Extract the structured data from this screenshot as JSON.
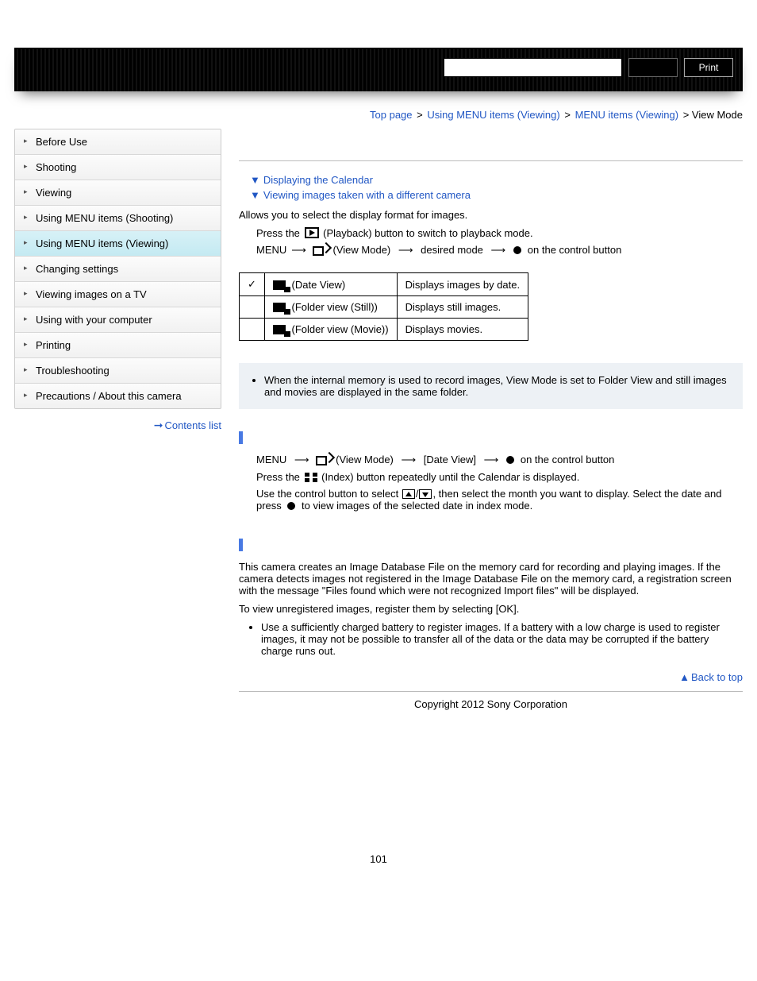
{
  "header": {
    "print_label": "Print"
  },
  "breadcrumbs": {
    "items": [
      "Top page",
      "Using MENU items (Viewing)",
      "MENU items (Viewing)"
    ],
    "current": "View Mode",
    "sep": ">"
  },
  "sidebar": {
    "items": [
      {
        "label": "Before Use"
      },
      {
        "label": "Shooting"
      },
      {
        "label": "Viewing"
      },
      {
        "label": "Using MENU items (Shooting)"
      },
      {
        "label": "Using MENU items (Viewing)",
        "active": true
      },
      {
        "label": "Changing settings"
      },
      {
        "label": "Viewing images on a TV"
      },
      {
        "label": "Using with your computer"
      },
      {
        "label": "Printing"
      },
      {
        "label": "Troubleshooting"
      },
      {
        "label": "Precautions / About this camera"
      }
    ],
    "contents_link": "Contents list"
  },
  "anchors": {
    "a1": "Displaying the Calendar",
    "a2": "Viewing images taken with a different camera"
  },
  "intro": "Allows you to select the display format for images.",
  "step1_a": "Press the ",
  "step1_b": " (Playback) button to switch to playback mode.",
  "step2_a": "MENU",
  "step2_b": " (View Mode) ",
  "step2_c": " desired mode ",
  "step2_d": " on the control button",
  "table": {
    "r1c1": " (Date View)",
    "r1c2": "Displays images by date.",
    "r2c1": " (Folder view (Still))",
    "r2c2": "Displays still images.",
    "r3c1": " (Folder view (Movie))",
    "r3c2": "Displays movies."
  },
  "note1": "When the internal memory is used to record images, View Mode is set to Folder View and still images and movies are displayed in the same folder.",
  "calendar": {
    "s1a": "MENU ",
    "s1b": " (View Mode) ",
    "s1c": " [Date View] ",
    "s1d": " on the control button",
    "s2a": "Press the ",
    "s2b": " (Index) button repeatedly until the Calendar is displayed.",
    "s3a": "Use the control button to select ",
    "s3b": ", then select the month you want to display. Select the date and press ",
    "s3c": " to view images of the selected date in index mode."
  },
  "diffcam": {
    "p1": "This camera creates an Image Database File on the memory card for recording and playing images. If the camera detects images not registered in the Image Database File on the memory card, a registration screen with the message \"Files found which were not recognized Import files\" will be displayed.",
    "p2": "To view unregistered images, register them by selecting [OK].",
    "bullet": "Use a sufficiently charged battery to register images. If a battery with a low charge is used to register images, it may not be possible to transfer all of the data or the data may be corrupted if the battery charge runs out."
  },
  "back_to_top": "Back to top",
  "copyright": "Copyright 2012 Sony Corporation",
  "page_number": "101"
}
